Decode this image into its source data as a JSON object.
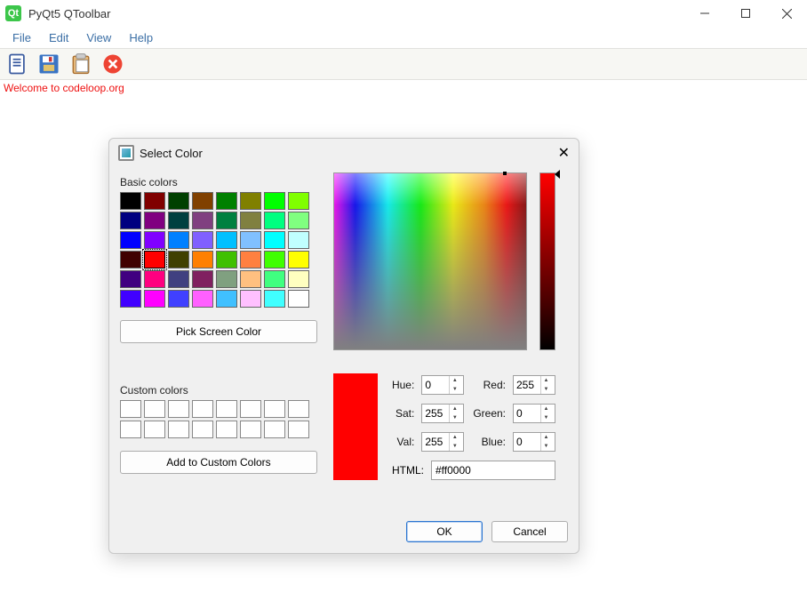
{
  "window": {
    "title": "PyQt5 QToolbar"
  },
  "menubar": [
    "File",
    "Edit",
    "View",
    "Help"
  ],
  "status": "Welcome to codeloop.org",
  "dialog": {
    "title": "Select Color",
    "basic_label": "Basic colors",
    "custom_label": "Custom colors",
    "pick_screen": "Pick Screen Color",
    "add_custom": "Add to Custom Colors",
    "hue_label": "Hue:",
    "sat_label": "Sat:",
    "val_label": "Val:",
    "red_label": "Red:",
    "green_label": "Green:",
    "blue_label": "Blue:",
    "html_label": "HTML:",
    "hue": 0,
    "sat": 255,
    "val": 255,
    "red": 255,
    "green": 0,
    "blue": 0,
    "html": "#ff0000",
    "ok": "OK",
    "cancel": "Cancel"
  },
  "basic_colors": [
    "#000000",
    "#800000",
    "#004000",
    "#804000",
    "#008000",
    "#808000",
    "#00ff00",
    "#80ff00",
    "#000080",
    "#800080",
    "#004040",
    "#804080",
    "#008040",
    "#808040",
    "#00ff80",
    "#80ff80",
    "#0000ff",
    "#8000ff",
    "#0080ff",
    "#8060ff",
    "#00c0ff",
    "#80c0ff",
    "#00ffff",
    "#c0ffff",
    "#400000",
    "#ff0000",
    "#404000",
    "#ff8000",
    "#40c000",
    "#ff8040",
    "#40ff00",
    "#ffff00",
    "#400080",
    "#ff0080",
    "#404080",
    "#802060",
    "#80a080",
    "#ffc080",
    "#40ff80",
    "#ffffc0",
    "#4000ff",
    "#ff00ff",
    "#4040ff",
    "#ff60ff",
    "#40c0ff",
    "#ffc0ff",
    "#40ffff",
    "#ffffff"
  ],
  "selected_basic_index": 25
}
